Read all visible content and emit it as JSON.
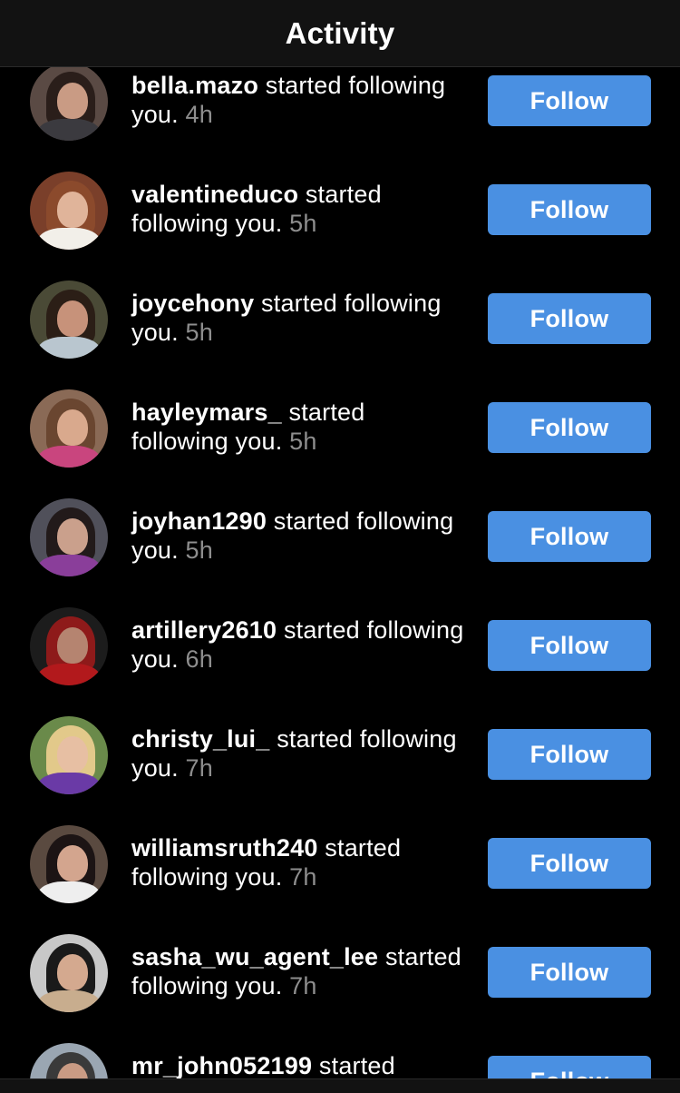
{
  "header": {
    "title": "Activity"
  },
  "activity_items": [
    {
      "username": "bella.mazo",
      "action": "started following you.",
      "time": "4h",
      "button": "Follow",
      "avatar": {
        "bg": "#5a4a44",
        "hair": "#2a1e1a",
        "face": "#c99b84",
        "body": "#3b3a3f"
      }
    },
    {
      "username": "valentineduco",
      "action": "started following you.",
      "time": "5h",
      "button": "Follow",
      "avatar": {
        "bg": "#7a3f2a",
        "hair": "#8b4a2c",
        "face": "#e0b49a",
        "body": "#f2efe9"
      }
    },
    {
      "username": "joycehony",
      "action": "started following you.",
      "time": "5h",
      "button": "Follow",
      "avatar": {
        "bg": "#4a4a36",
        "hair": "#2b1e16",
        "face": "#c7927a",
        "body": "#b9c6cf"
      }
    },
    {
      "username": "hayleymars_",
      "action": "started following you.",
      "time": "5h",
      "button": "Follow",
      "avatar": {
        "bg": "#8a6a56",
        "hair": "#6a4630",
        "face": "#d9a98d",
        "body": "#c9457e"
      }
    },
    {
      "username": "joyhan1290",
      "action": "started following you.",
      "time": "5h",
      "button": "Follow",
      "avatar": {
        "bg": "#50505a",
        "hair": "#221a1a",
        "face": "#caa08c",
        "body": "#8a3e9a"
      }
    },
    {
      "username": "artillery2610",
      "action": "started following you.",
      "time": "6h",
      "button": "Follow",
      "avatar": {
        "bg": "#1c1c1c",
        "hair": "#8e1a1a",
        "face": "#b58470",
        "body": "#b2191c"
      }
    },
    {
      "username": "christy_lui_",
      "action": "started following you.",
      "time": "7h",
      "button": "Follow",
      "avatar": {
        "bg": "#6a8a4a",
        "hair": "#e2c98a",
        "face": "#e7bfa3",
        "body": "#6a3aa6"
      }
    },
    {
      "username": "williamsruth240",
      "action": "started following you.",
      "time": "7h",
      "button": "Follow",
      "avatar": {
        "bg": "#5a4a40",
        "hair": "#1c1414",
        "face": "#d3a58e",
        "body": "#eeeeee"
      }
    },
    {
      "username": "sasha_wu_agent_lee",
      "action": "started following you.",
      "time": "7h",
      "button": "Follow",
      "avatar": {
        "bg": "#c8c8c8",
        "hair": "#1a1a1a",
        "face": "#d4a98f",
        "body": "#c8ad8e"
      }
    },
    {
      "username": "mr_john052199",
      "action": "started following you.",
      "time": "",
      "button": "Follow",
      "avatar": {
        "bg": "#9aa6b2",
        "hair": "#3a3a3a",
        "face": "#c99b84",
        "body": "#2a2a2a"
      }
    }
  ],
  "colors": {
    "background": "#000000",
    "button": "#4a90e2",
    "time": "#8e8e8e",
    "header_bg": "#121212"
  }
}
